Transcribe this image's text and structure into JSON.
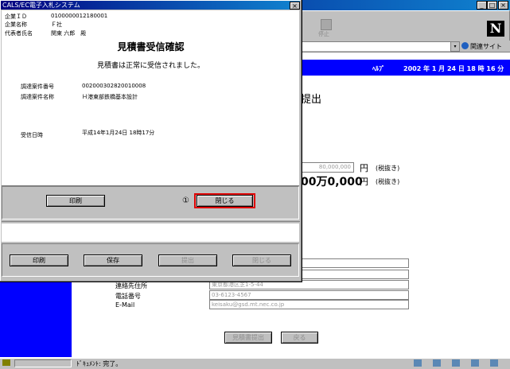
{
  "browser": {
    "titlebar_buttons": [
      "_",
      "□",
      "×"
    ],
    "stop_label": "停止",
    "logo_letter": "N",
    "related_sites": "関連サイト",
    "header_help": "ﾍﾙﾌﾟ",
    "header_date": "2002 年 1 月 24 日 18 時 16 分",
    "page_heading_fragment": "提出",
    "amount_field": "80,000,000",
    "amount_unit": "円",
    "tax_note": "(税抜き)",
    "amount_big": "00万0,000",
    "amount_big_unit": "円",
    "tax_note_2": "(税抜き)",
    "contact_labels": [
      "連絡先住所",
      "電話番号",
      "E-Mail"
    ],
    "contact_values": [
      "東京都港区芝1-5-44",
      "03-6123-4567",
      "keisaku@gsd.mt.nec.co.jp"
    ],
    "btn_submit_quote": "見積書提出",
    "btn_back": "戻る",
    "status_text": "ﾄﾞｷｭﾒﾝﾄ: 完了。"
  },
  "dialog": {
    "title": "CALS/EC電子入札システム",
    "close_glyph": "×",
    "company_info": [
      {
        "label": "企業ＩＤ",
        "value": "0100000012180001"
      },
      {
        "label": "企業名称",
        "value": "Ｆ社"
      },
      {
        "label": "代表者氏名",
        "value": "関東 六郎　殿"
      }
    ],
    "heading": "見積書受信確認",
    "message": "見積書は正常に受信されました。",
    "details": [
      {
        "label": "調達案件番号",
        "value": "002000302820010008"
      },
      {
        "label": "調達案件名称",
        "value": "Ｈ港東部鉄橋基本設計"
      }
    ],
    "received_label": "受信日時",
    "received_value": "平成14年1月24日 18時17分",
    "btn_print": "印刷",
    "marker": "①",
    "btn_close": "閉じる",
    "bottom_buttons": [
      {
        "label": "印刷",
        "enabled": true
      },
      {
        "label": "保存",
        "enabled": true
      },
      {
        "label": "提出",
        "enabled": false
      },
      {
        "label": "閉じる",
        "enabled": false
      }
    ],
    "highlight_color": "#e00000"
  },
  "colors": {
    "titlebar_start": "#000080",
    "titlebar_end": "#1084d0",
    "header_blue": "#0000ff"
  }
}
